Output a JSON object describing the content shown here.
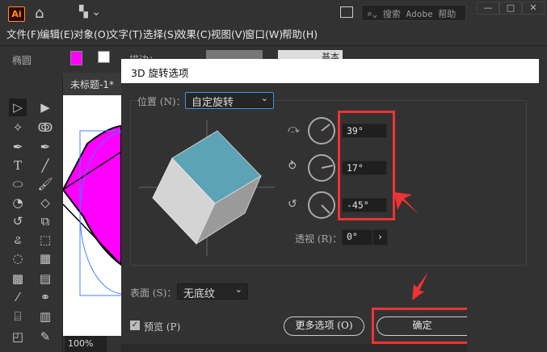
{
  "app": {
    "logo": "Ai",
    "search_placeholder": "搜索 Adobe 帮助",
    "window_controls": [
      "—",
      "□",
      "✕"
    ]
  },
  "menu": [
    "文件(F)",
    "编辑(E)",
    "对象(O)",
    "文字(T)",
    "选择(S)",
    "效果(C)",
    "视图(V)",
    "窗口(W)",
    "帮助(H)"
  ],
  "control_bar": {
    "shape_label": "椭圆",
    "fill_color": "#ff00ff",
    "stroke_label": "描边：",
    "style_label": "基本"
  },
  "document": {
    "tab_title": "未标题-1*",
    "zoom": "100%"
  },
  "dialog": {
    "title": "3D 旋转选项",
    "position_label": "位置 (N)：",
    "position_value": "自定旋转",
    "rotation_x": "39°",
    "rotation_y": "17°",
    "rotation_z": "-45°",
    "perspective_label": "透视 (R)：",
    "perspective_value": "0°",
    "surface_label": "表面 (S)：",
    "surface_value": "无底纹",
    "preview_label": "预览 (P)",
    "preview_checked": true,
    "more_options_label": "更多选项 (O)",
    "ok_label": "确定",
    "cube_top_color": "#5ba3b5",
    "highlight_color": "#f03333"
  }
}
